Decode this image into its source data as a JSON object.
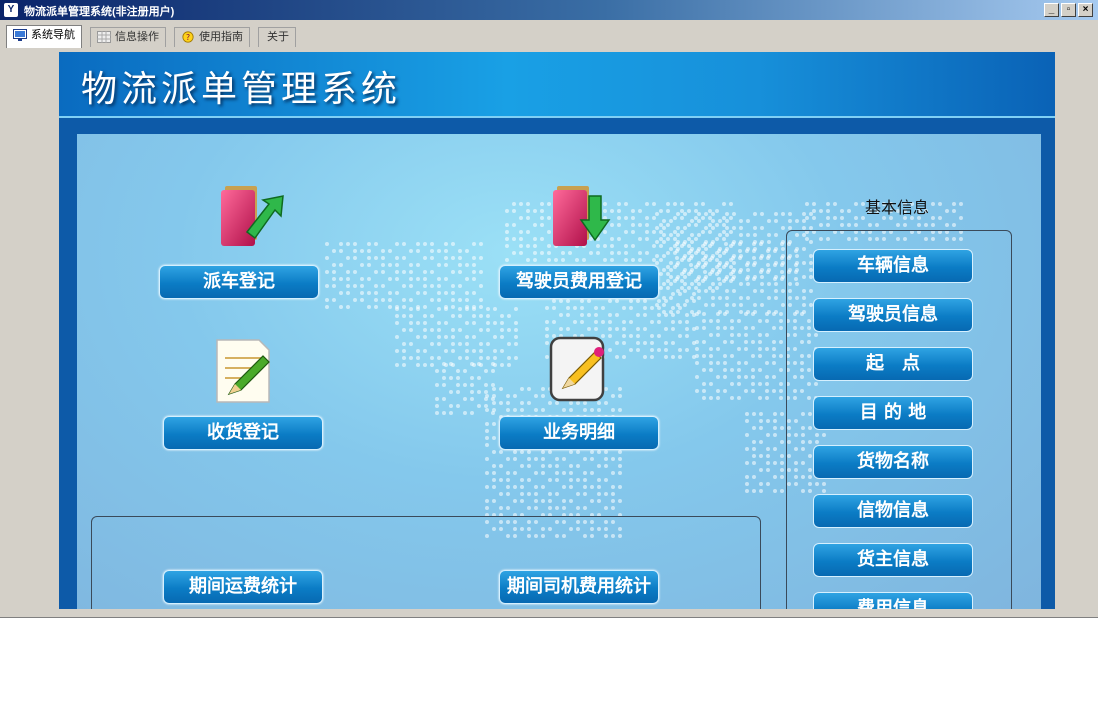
{
  "window": {
    "title": "物流派单管理系统(非注册用户)",
    "icon": "app-logo-icon",
    "controls": [
      "minimize-icon",
      "restore-icon",
      "close-icon"
    ]
  },
  "tabs": [
    {
      "label": "系统导航",
      "icon": "monitor-icon",
      "active": true
    },
    {
      "label": "信息操作",
      "icon": "grid-icon",
      "active": false
    },
    {
      "label": "使用指南",
      "icon": "help-icon",
      "active": false
    },
    {
      "label": "关于",
      "icon": "",
      "active": false
    }
  ],
  "header": {
    "title": "物流派单管理系统"
  },
  "main_buttons": {
    "dispatch": "派车登记",
    "driver_expense": "驾驶员费用登记",
    "receiving": "收货登记",
    "business_detail": "业务明细",
    "period_freight": "期间运费统计",
    "period_driver_expense": "期间司机费用统计"
  },
  "main_icons": {
    "dispatch": "folder-arrow-icon",
    "driver_expense": "folder-download-icon",
    "receiving": "notepad-pencil-icon",
    "business_detail": "document-edit-icon"
  },
  "basic_info": {
    "title": "基本信息",
    "items": [
      "车辆信息",
      "驾驶员信息",
      "起　点",
      "目 的 地",
      "货物名称",
      "信物信息",
      "货主信息",
      "费用信息"
    ]
  },
  "colors": {
    "accent": "#0b7cc5",
    "header": "#19a0e5",
    "panel": "#84c8ec",
    "frame": "#0d5aa8"
  }
}
